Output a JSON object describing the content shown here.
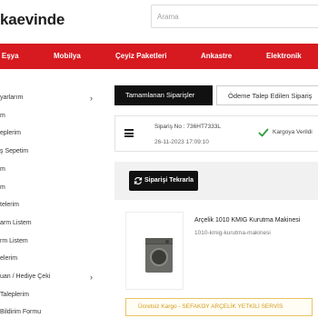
{
  "header": {
    "logo_text": "kaevinde",
    "search_placeholder": "Arama"
  },
  "nav": {
    "items": [
      {
        "label": "t Eşya"
      },
      {
        "label": "Mobilya"
      },
      {
        "label": "Çeyiz Paketleri"
      },
      {
        "label": "Ankastre"
      },
      {
        "label": "Elektronik"
      }
    ]
  },
  "sidebar": {
    "items": [
      {
        "label": "yarlarım",
        "has_children": true
      },
      {
        "label": "m",
        "has_children": false
      },
      {
        "label": "eplerim",
        "has_children": false
      },
      {
        "label": "ş Sepetim",
        "has_children": false
      },
      {
        "label": "m",
        "has_children": false
      },
      {
        "label": "m",
        "has_children": false
      },
      {
        "label": "telerim",
        "has_children": false
      },
      {
        "label": "arm Listem",
        "has_children": false
      },
      {
        "label": "rm Listem",
        "has_children": false
      },
      {
        "label": "elerim",
        "has_children": false
      },
      {
        "label": "uan / Hediye Çeki",
        "has_children": true
      },
      {
        "label": "Taleplerim",
        "has_children": false
      },
      {
        "label": "Bildirim Formu",
        "has_children": false
      }
    ]
  },
  "tabs": {
    "completed": "Tamamlanan Siparişler",
    "refund_requested": "Ödeme Talep Edilen Sipariş"
  },
  "order": {
    "number": "Sipariş No : 736HT7333L",
    "date": "26-11-2023 17:09:10",
    "status": "Kargoya Verildi",
    "status_color": "#2e9e3c",
    "reorder_label": "Siparişi Tekrarla"
  },
  "product": {
    "name": "Arçelik 1010 KMIG Kurutma Makinesi",
    "sku": "1010-kmig-kurutma-makinesi",
    "image_icon": "dryer-image"
  },
  "shipping_note": "Ücretsiz Kargo - SEFAKOY ARÇELİK YETKİLİ SERVİS",
  "colors": {
    "brand_red": "#d71920",
    "note_border": "#e7c460",
    "note_text": "#d39a1a"
  }
}
